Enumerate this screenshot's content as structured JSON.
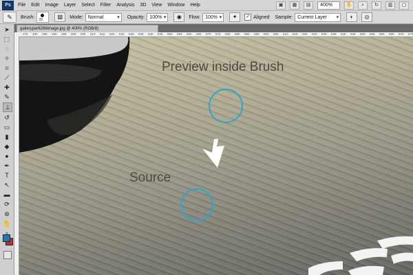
{
  "app": {
    "logo": "Ps"
  },
  "menu": [
    "File",
    "Edit",
    "Image",
    "Layer",
    "Select",
    "Filter",
    "Analysis",
    "3D",
    "View",
    "Window",
    "Help"
  ],
  "toolbar_right": {
    "zoom": "400%"
  },
  "options": {
    "brush_label": "Brush:",
    "brush_size": "33",
    "mode_label": "Mode:",
    "mode_value": "Normal",
    "opacity_label": "Opacity:",
    "opacity_value": "100%",
    "flow_label": "Flow:",
    "flow_value": "100%",
    "aligned_label": "Aligned",
    "sample_label": "Sample:",
    "sample_value": "Current Layer"
  },
  "document": {
    "tab_title": "gallerypar6266image.jpg @ 400% (RGB/8)",
    "ruler_ticks": [
      "475",
      "480",
      "485",
      "490",
      "495",
      "500",
      "505",
      "510",
      "515",
      "520",
      "525",
      "530",
      "535",
      "540",
      "545",
      "550",
      "555",
      "560",
      "565",
      "570",
      "575",
      "580",
      "585",
      "590",
      "595",
      "600",
      "605",
      "610",
      "615",
      "620",
      "625",
      "630",
      "635",
      "640",
      "645",
      "650",
      "655",
      "660",
      "665",
      "670",
      "675",
      "680"
    ]
  },
  "annotations": {
    "preview_label": "Preview inside Brush",
    "source_label": "Source"
  },
  "colors": {
    "accent_circle": "#2aa7cc",
    "foreground": "#2277b0",
    "background": "#c62d2d"
  }
}
